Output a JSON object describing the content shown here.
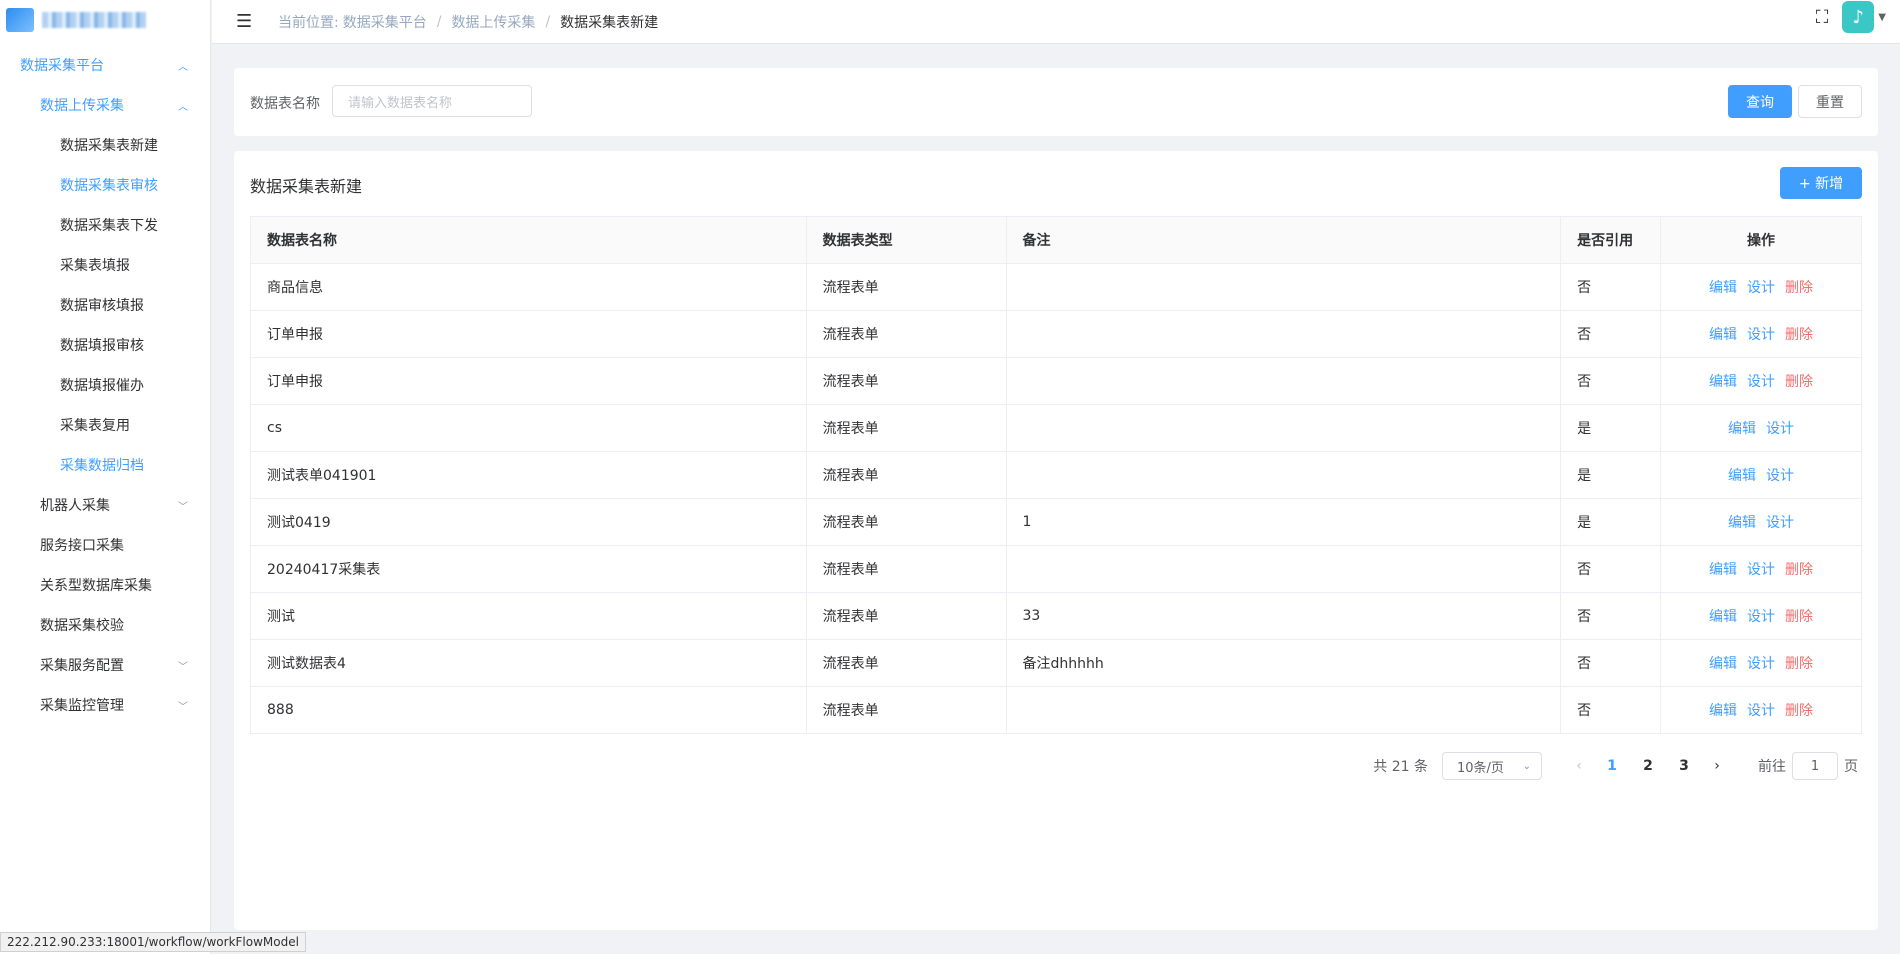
{
  "sidebar": {
    "items": [
      {
        "label": "数据采集平台",
        "level": 1,
        "active": true,
        "arrow": "up"
      },
      {
        "label": "数据上传采集",
        "level": 2,
        "active": true,
        "arrow": "up"
      },
      {
        "label": "数据采集表新建",
        "level": 3,
        "active": false
      },
      {
        "label": "数据采集表审核",
        "level": 3,
        "active": true
      },
      {
        "label": "数据采集表下发",
        "level": 3,
        "active": false
      },
      {
        "label": "采集表填报",
        "level": 3,
        "active": false
      },
      {
        "label": "数据审核填报",
        "level": 3,
        "active": false
      },
      {
        "label": "数据填报审核",
        "level": 3,
        "active": false
      },
      {
        "label": "数据填报催办",
        "level": 3,
        "active": false
      },
      {
        "label": "采集表复用",
        "level": 3,
        "active": false
      },
      {
        "label": "采集数据归档",
        "level": 3,
        "active": true
      },
      {
        "label": "机器人采集",
        "level": 2,
        "active": false,
        "arrow": "down"
      },
      {
        "label": "服务接口采集",
        "level": 2,
        "active": false
      },
      {
        "label": "关系型数据库采集",
        "level": 2,
        "active": false
      },
      {
        "label": "数据采集校验",
        "level": 2,
        "active": false
      },
      {
        "label": "采集服务配置",
        "level": 2,
        "active": false,
        "arrow": "down"
      },
      {
        "label": "采集监控管理",
        "level": 2,
        "active": false,
        "arrow": "down"
      }
    ]
  },
  "header": {
    "breadcrumb_prefix": "当前位置:",
    "breadcrumb": [
      "数据采集平台",
      "数据上传采集",
      "数据采集表新建"
    ]
  },
  "search": {
    "label": "数据表名称",
    "placeholder": "请输入数据表名称",
    "query_button": "查询",
    "reset_button": "重置"
  },
  "panel": {
    "title": "数据采集表新建",
    "add_button": "+ 新增"
  },
  "table": {
    "columns": [
      "数据表名称",
      "数据表类型",
      "备注",
      "是否引用",
      "操作"
    ],
    "op_labels": {
      "edit": "编辑",
      "design": "设计",
      "delete": "删除"
    },
    "rows": [
      {
        "name": "商品信息",
        "type": "流程表单",
        "remark": "",
        "ref": "否",
        "ops": [
          "edit",
          "design",
          "delete"
        ]
      },
      {
        "name": "订单申报",
        "type": "流程表单",
        "remark": "",
        "ref": "否",
        "ops": [
          "edit",
          "design",
          "delete"
        ]
      },
      {
        "name": "订单申报",
        "type": "流程表单",
        "remark": "",
        "ref": "否",
        "ops": [
          "edit",
          "design",
          "delete"
        ]
      },
      {
        "name": "cs",
        "type": "流程表单",
        "remark": "",
        "ref": "是",
        "ops": [
          "edit",
          "design"
        ]
      },
      {
        "name": "测试表单041901",
        "type": "流程表单",
        "remark": "",
        "ref": "是",
        "ops": [
          "edit",
          "design"
        ]
      },
      {
        "name": "测试0419",
        "type": "流程表单",
        "remark": "1",
        "ref": "是",
        "ops": [
          "edit",
          "design"
        ]
      },
      {
        "name": "20240417采集表",
        "type": "流程表单",
        "remark": "",
        "ref": "否",
        "ops": [
          "edit",
          "design",
          "delete"
        ]
      },
      {
        "name": "测试",
        "type": "流程表单",
        "remark": "33",
        "ref": "否",
        "ops": [
          "edit",
          "design",
          "delete"
        ]
      },
      {
        "name": "测试数据表4",
        "type": "流程表单",
        "remark": "备注dhhhhh",
        "ref": "否",
        "ops": [
          "edit",
          "design",
          "delete"
        ]
      },
      {
        "name": "888",
        "type": "流程表单",
        "remark": "",
        "ref": "否",
        "ops": [
          "edit",
          "design",
          "delete"
        ]
      }
    ]
  },
  "pagination": {
    "total_text": "共 21 条",
    "page_size": "10条/页",
    "pages": [
      "1",
      "2",
      "3"
    ],
    "current_page": "1",
    "goto_prefix": "前往",
    "goto_value": "1",
    "goto_suffix": "页"
  },
  "statusbar": {
    "url": "222.212.90.233:18001/workflow/workFlowModel"
  },
  "colors": {
    "accent": "#409eff",
    "danger": "#f56c6c",
    "avatar": "#3cc7c7"
  }
}
